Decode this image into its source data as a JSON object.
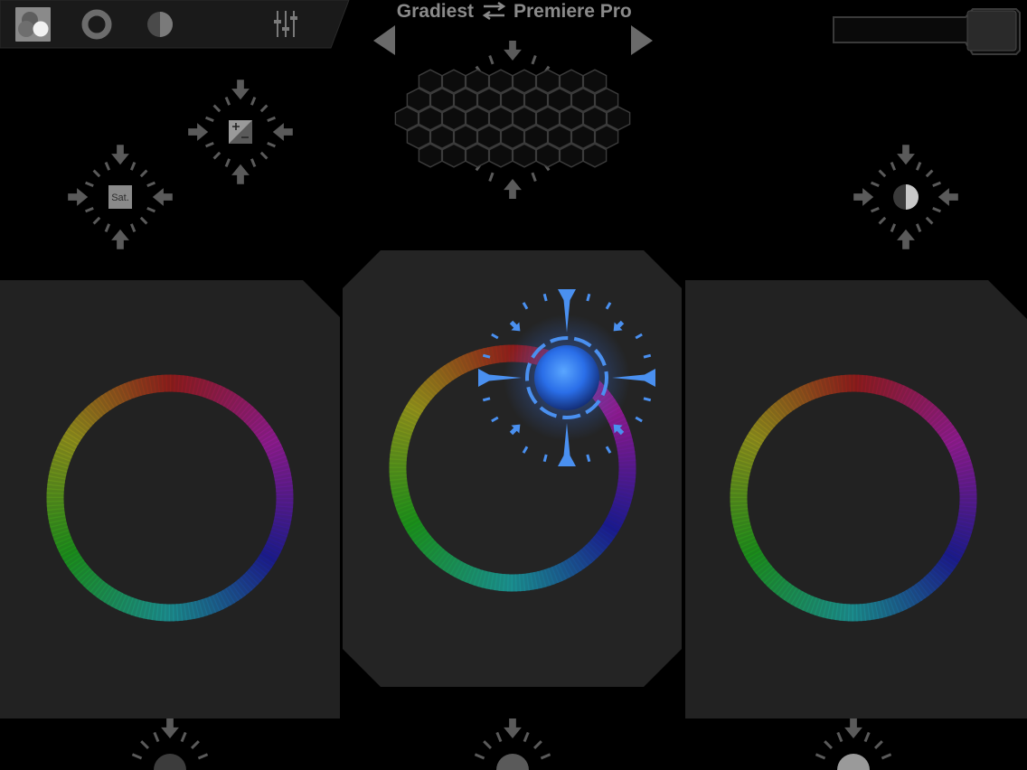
{
  "header": {
    "title_left": "Gradiest",
    "title_right": "Premiere Pro",
    "swap_icon": "swap-arrows-icon",
    "prev_icon": "triangle-left-icon",
    "next_icon": "triangle-right-icon"
  },
  "toolbar": {
    "tabs": [
      {
        "name": "color-wheels-mode",
        "icon": "overlapping-circles-icon",
        "selected": true
      },
      {
        "name": "ring-mode",
        "icon": "ring-icon",
        "selected": false
      },
      {
        "name": "contrast-mode",
        "icon": "half-circle-icon",
        "selected": false
      },
      {
        "name": "mixer-mode",
        "icon": "sliders-icon",
        "selected": false
      }
    ]
  },
  "top_slider": {
    "name": "master-slider",
    "value_fraction": 1.0
  },
  "controls": {
    "saturation_label": "Sat.",
    "exposure_icon": "plus-minus-icon",
    "contrast_icon": "half-circle-icon",
    "hexagon_grid_icon": "hexagon-grid-icon"
  },
  "panels": [
    {
      "name": "shadows-wheel",
      "active": false
    },
    {
      "name": "midtones-wheel",
      "active": true
    },
    {
      "name": "highlights-wheel",
      "active": false
    }
  ],
  "colors": {
    "background": "#000000",
    "panel": "#222222",
    "accent": "#4a90f0",
    "control_gray": "#555555"
  }
}
